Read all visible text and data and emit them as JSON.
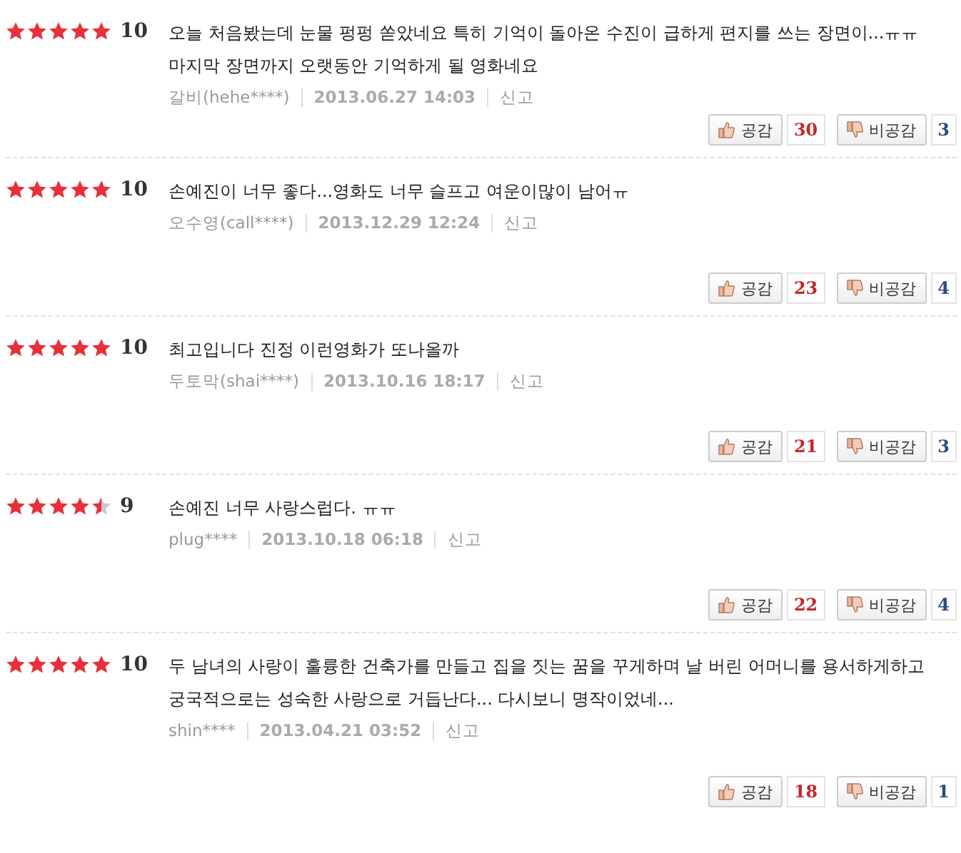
{
  "reviews": [
    {
      "stars": 5,
      "score": "10",
      "text": "오늘 처음봤는데 눈물 펑펑 쏟았네요 특히 기억이 돌아온 수진이 급하게 편지를 쓰는 장면이...ㅠㅠ마지막 장면까지 오랫동안 기억하게 될 영화네요",
      "author": "갈비(hehe****)",
      "date": "2013.06.27 14:03",
      "report": "신고",
      "like_label": "공감",
      "likes": "30",
      "dislike_label": "비공감",
      "dislikes": "3"
    },
    {
      "stars": 5,
      "score": "10",
      "text": "손예진이 너무 좋다...영화도 너무 슬프고 여운이많이 남어ㅠ",
      "author": "오수영(call****)",
      "date": "2013.12.29 12:24",
      "report": "신고",
      "like_label": "공감",
      "likes": "23",
      "dislike_label": "비공감",
      "dislikes": "4"
    },
    {
      "stars": 5,
      "score": "10",
      "text": "최고입니다 진정 이런영화가 또나올까",
      "author": "두토막(shai****)",
      "date": "2013.10.16 18:17",
      "report": "신고",
      "like_label": "공감",
      "likes": "21",
      "dislike_label": "비공감",
      "dislikes": "3"
    },
    {
      "stars": 4.5,
      "score": "9",
      "text": "손예진 너무 사랑스럽다. ㅠㅠ",
      "author": "plug****",
      "date": "2013.10.18 06:18",
      "report": "신고",
      "like_label": "공감",
      "likes": "22",
      "dislike_label": "비공감",
      "dislikes": "4"
    },
    {
      "stars": 5,
      "score": "10",
      "text": "두 남녀의 사랑이 훌륭한 건축가를 만들고 집을 짓는 꿈을 꾸게하며 날 버린 어머니를 용서하게하고 궁국적으로는 성숙한 사랑으로 거듭난다... 다시보니 명작이었네...",
      "author": "shin****",
      "date": "2013.04.21 03:52",
      "report": "신고",
      "like_label": "공감",
      "likes": "18",
      "dislike_label": "비공감",
      "dislikes": "1"
    }
  ]
}
